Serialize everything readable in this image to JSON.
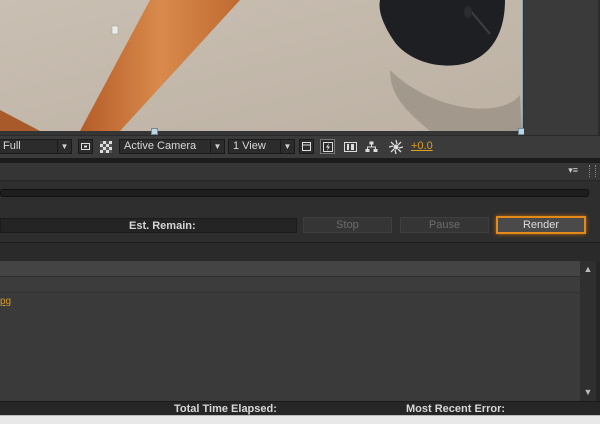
{
  "viewer": {
    "magnification": "Full",
    "camera": "Active Camera",
    "views": "1 View",
    "exposure": "+0.0"
  },
  "render_queue": {
    "est_remain_label": "Est. Remain:",
    "stop_label": "Stop",
    "pause_label": "Pause",
    "render_label": "Render",
    "item_name_fragment": "pg",
    "total_time_elapsed_label": "Total Time Elapsed:",
    "most_recent_error_label": "Most Recent Error:"
  },
  "colors": {
    "accent": "#e38a1b",
    "panel": "#2e2e2e",
    "link": "#d89a22"
  }
}
